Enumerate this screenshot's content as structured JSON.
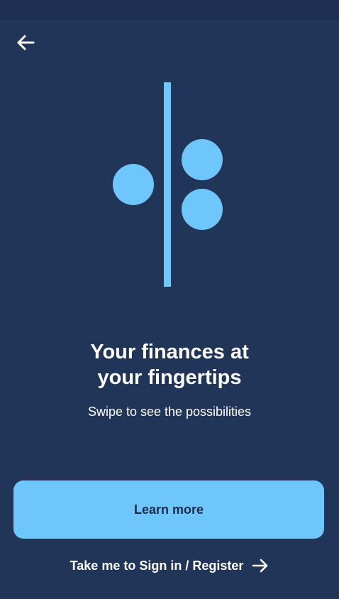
{
  "status_bar": {},
  "nav": {
    "back_icon": "arrow-left-icon"
  },
  "illustration": {
    "icon": "brand-dots-divider-logo",
    "color": "#6ec6fb"
  },
  "onboarding": {
    "title_line1": "Your finances at",
    "title_line2": "your fingertips",
    "subtitle": "Swipe to see the possibilities"
  },
  "actions": {
    "learn_more_label": "Learn more",
    "signin_label": "Take me to Sign in / Register",
    "signin_icon": "arrow-right-icon"
  },
  "colors": {
    "background": "#213559",
    "accent": "#6ec6fb",
    "button_text": "#1a2c4e",
    "text": "#ffffff"
  }
}
